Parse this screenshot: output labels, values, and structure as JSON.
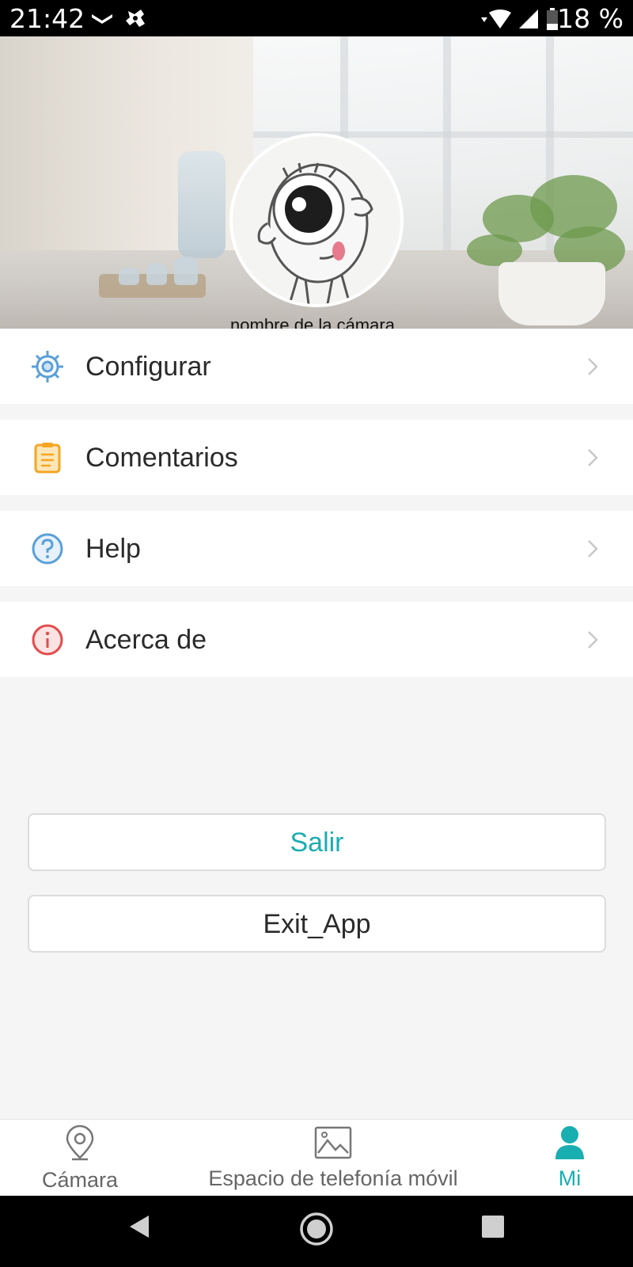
{
  "status_bar": {
    "time": "21:42",
    "battery": "18 %",
    "icons": [
      "notification-icon",
      "game-icon",
      "wifi-icon",
      "signal-icon",
      "battery-icon"
    ]
  },
  "header": {
    "camera_name": "nombre de la cámara",
    "avatar": "eyeball-mascot-icon"
  },
  "menu": [
    {
      "label": "Configurar",
      "icon": "gear-icon",
      "color": "#5aa0d8"
    },
    {
      "label": "Comentarios",
      "icon": "notepad-icon",
      "color": "#f5a623"
    },
    {
      "label": "Help",
      "icon": "help-icon",
      "color": "#5aa0d8"
    },
    {
      "label": "Acerca de",
      "icon": "info-icon",
      "color": "#e34b4b"
    }
  ],
  "buttons": {
    "logout": "Salir",
    "exit_app": "Exit_App"
  },
  "tabs": [
    {
      "label": "Cámara",
      "icon": "location-pin-icon"
    },
    {
      "label": "Espacio de telefonía móvil",
      "icon": "picture-icon"
    },
    {
      "label": "Mi",
      "icon": "person-icon",
      "active": true
    }
  ],
  "colors": {
    "accent": "#19aeb0",
    "background": "#f5f5f5"
  }
}
